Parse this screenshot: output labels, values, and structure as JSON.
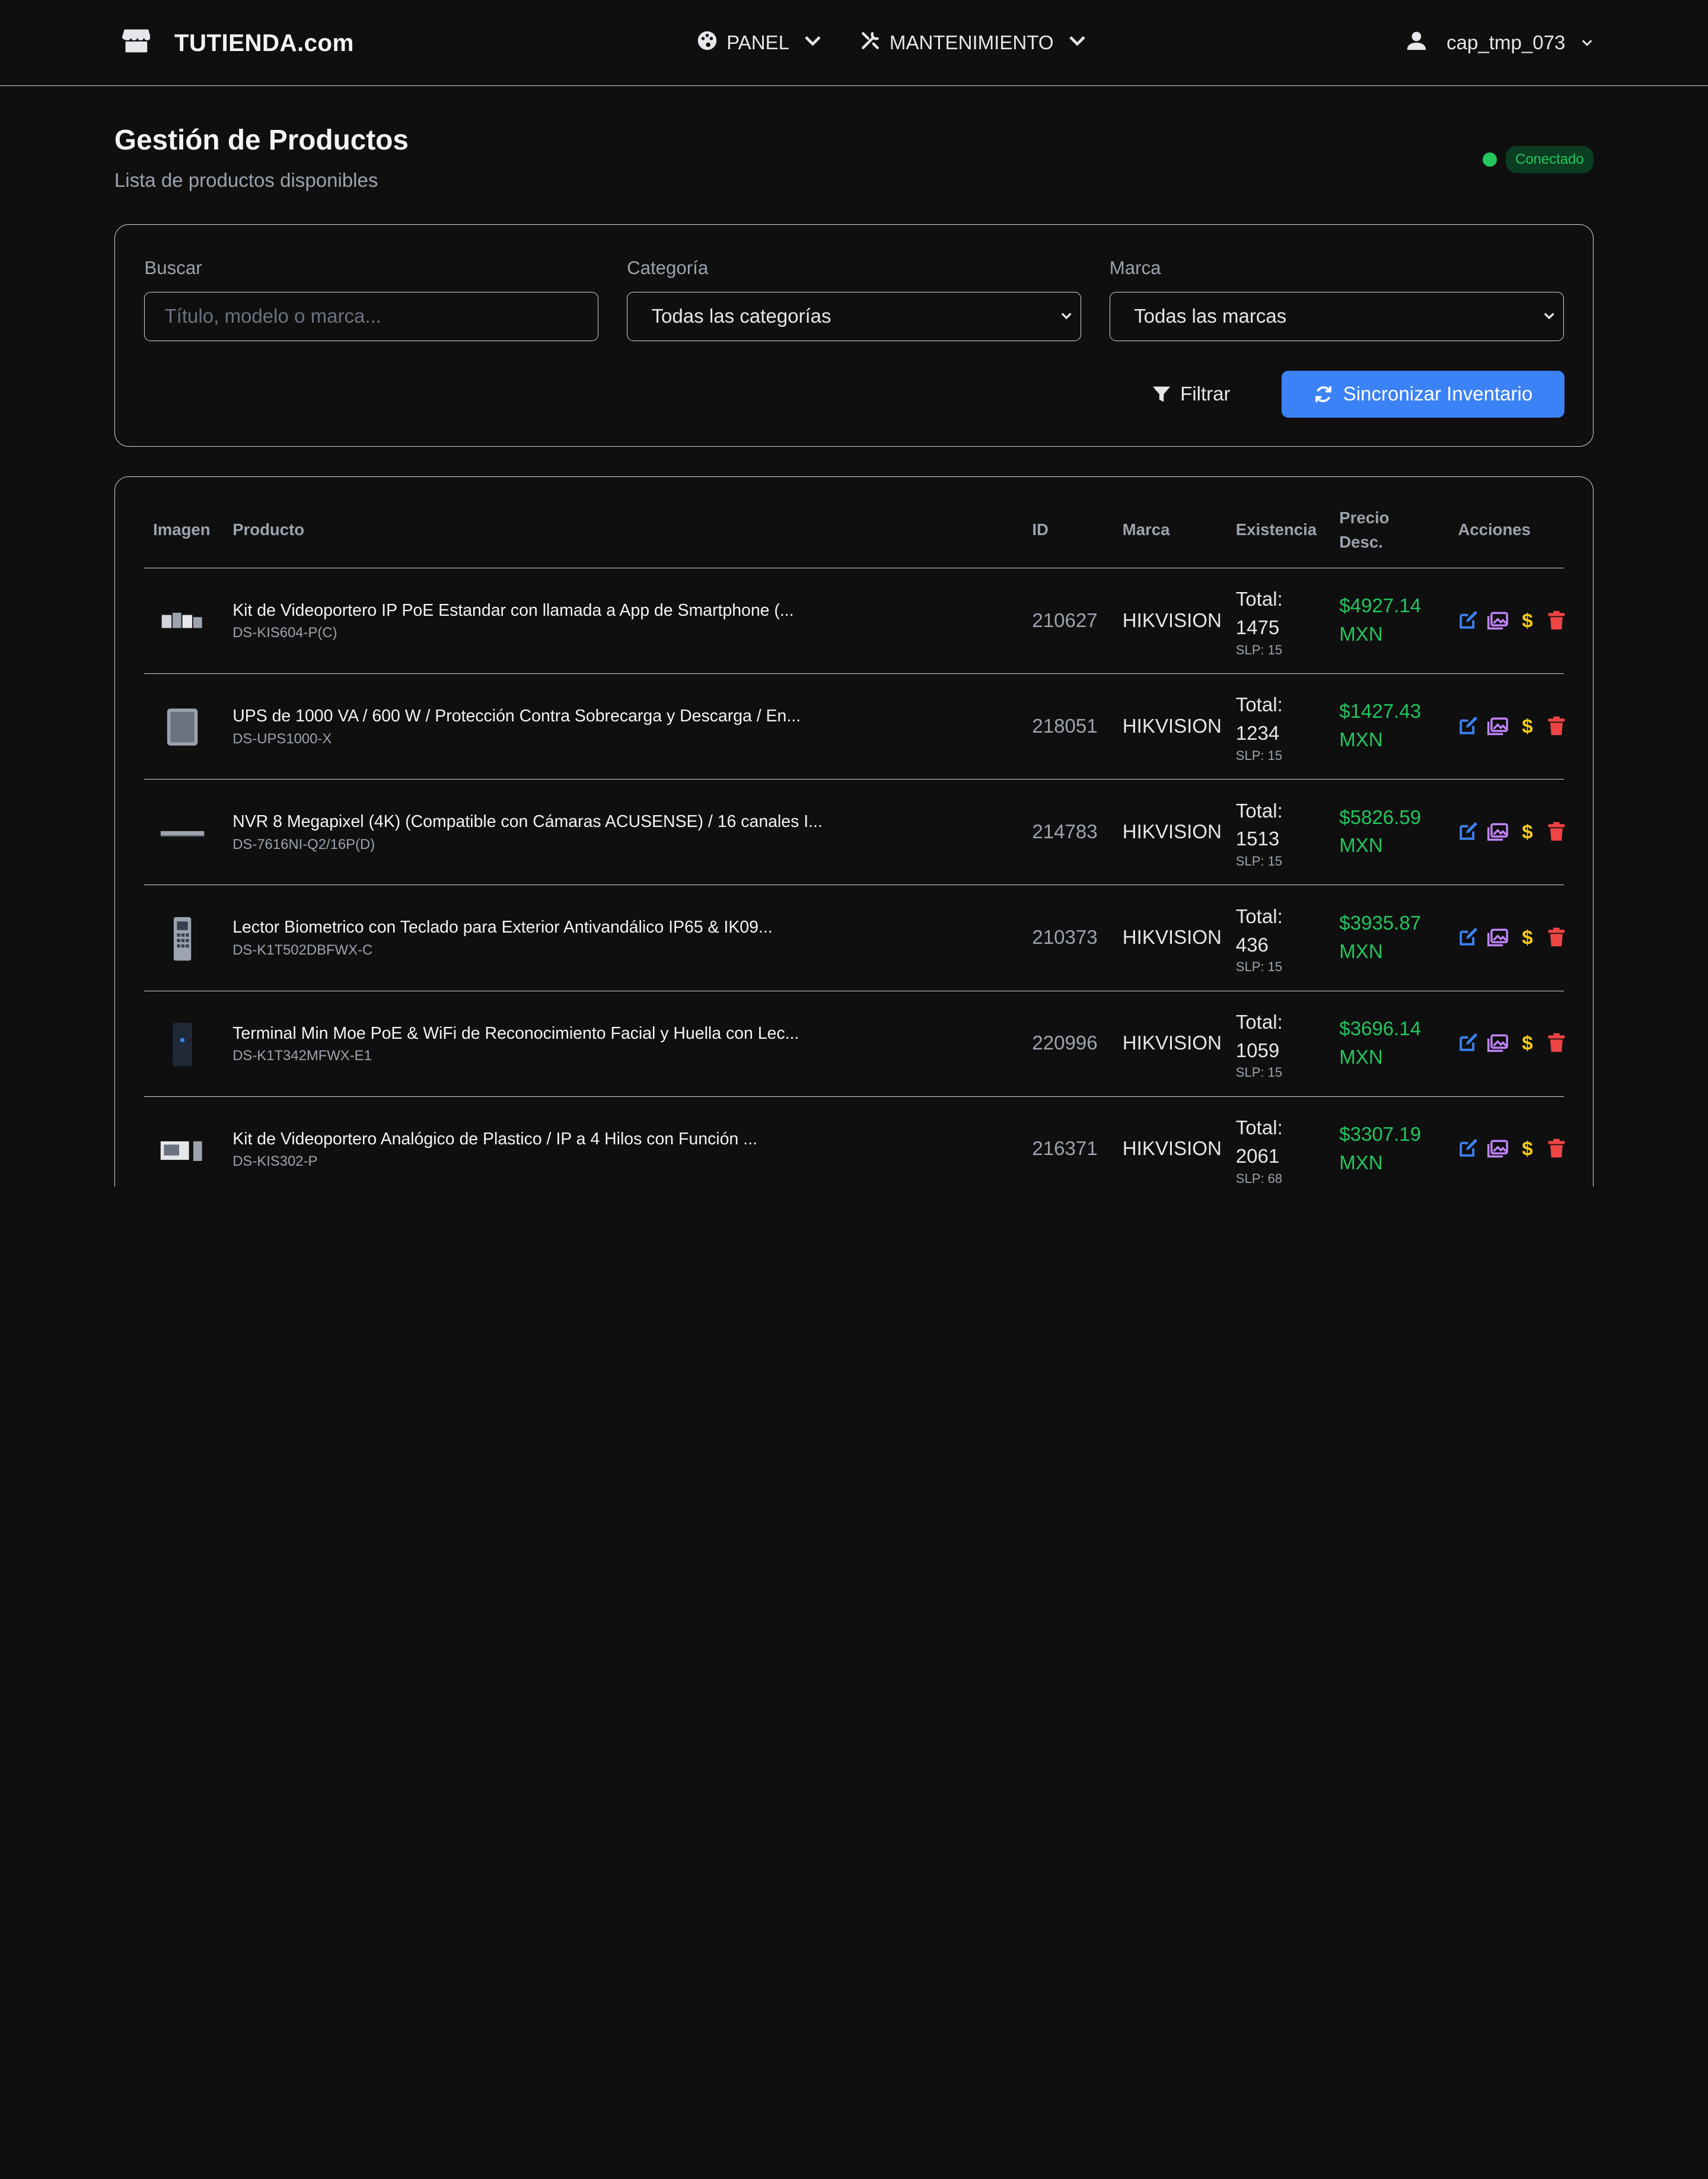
{
  "nav": {
    "brand": "TUTIENDA.com",
    "panel": "PANEL",
    "maintenance": "MANTENIMIENTO",
    "user": "cap_tmp_073"
  },
  "header": {
    "title": "Gestión de Productos",
    "subtitle": "Lista de productos disponibles",
    "status": "Conectado"
  },
  "filters": {
    "search_label": "Buscar",
    "search_placeholder": "Título, modelo o marca...",
    "category_label": "Categoría",
    "category_value": "Todas las categorías",
    "brand_label": "Marca",
    "brand_value": "Todas las marcas",
    "filter_button": "Filtrar",
    "sync_button": "Sincronizar Inventario"
  },
  "table": {
    "headers": {
      "image": "Imagen",
      "product": "Producto",
      "id": "ID",
      "brand": "Marca",
      "stock": "Existencia",
      "price_line1": "Precio",
      "price_line2": "Desc.",
      "actions": "Acciones"
    },
    "rows": [
      {
        "title": "Kit de Videoportero IP PoE Estandar con llamada a App de Smartphone (...",
        "model": "DS-KIS604-P(C)",
        "id": "210627",
        "brand": "HIKVISION",
        "total_label": "Total:",
        "total": "1475",
        "slp": "SLP: 15",
        "price": "$4927.14",
        "currency": "MXN",
        "thumb_icon": "intercom-kit-icon"
      },
      {
        "title": "UPS de 1000 VA / 600 W / Protección Contra Sobrecarga y Descarga / En...",
        "model": "DS-UPS1000-X",
        "id": "218051",
        "brand": "HIKVISION",
        "total_label": "Total:",
        "total": "1234",
        "slp": "SLP: 15",
        "price": "$1427.43",
        "currency": "MXN",
        "thumb_icon": "ups-icon"
      },
      {
        "title": "NVR 8 Megapixel (4K) (Compatible con Cámaras ACUSENSE) / 16 canales I...",
        "model": "DS-7616NI-Q2/16P(D)",
        "id": "214783",
        "brand": "HIKVISION",
        "total_label": "Total:",
        "total": "1513",
        "slp": "SLP: 15",
        "price": "$5826.59",
        "currency": "MXN",
        "thumb_icon": "nvr-icon"
      },
      {
        "title": "Lector Biometrico con Teclado para Exterior Antivandálico IP65 & IK09...",
        "model": "DS-K1T502DBFWX-C",
        "id": "210373",
        "brand": "HIKVISION",
        "total_label": "Total:",
        "total": "436",
        "slp": "SLP: 15",
        "price": "$3935.87",
        "currency": "MXN",
        "thumb_icon": "keypad-reader-icon"
      },
      {
        "title": "Terminal Min Moe PoE & WiFi de Reconocimiento Facial y Huella con Lec...",
        "model": "DS-K1T342MFWX-E1",
        "id": "220996",
        "brand": "HIKVISION",
        "total_label": "Total:",
        "total": "1059",
        "slp": "SLP: 15",
        "price": "$3696.14",
        "currency": "MXN",
        "thumb_icon": "face-terminal-icon"
      },
      {
        "title": "Kit de Videoportero Analógico de Plastico / IP a 4 Hilos con Función ...",
        "model": "DS-KIS302-P",
        "id": "216371",
        "brand": "HIKVISION",
        "total_label": "Total:",
        "total": "2061",
        "slp": "SLP: 68",
        "price": "$3307.19",
        "currency": "MXN",
        "thumb_icon": "analog-intercom-icon"
      }
    ]
  },
  "colors": {
    "accent": "#3b82f6",
    "success": "#22c55e",
    "edit": "#3b82f6",
    "gallery": "#c084fc",
    "price_action": "#facc15",
    "delete": "#ef4444"
  }
}
